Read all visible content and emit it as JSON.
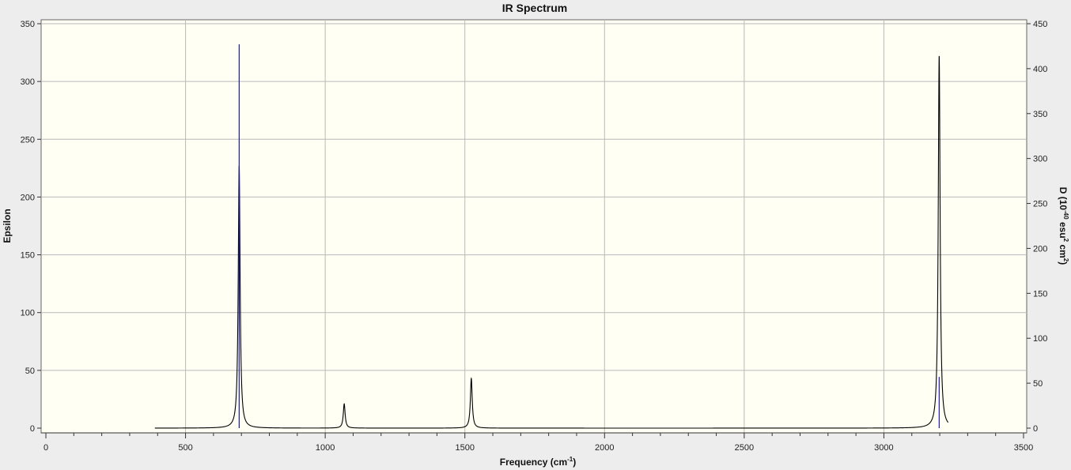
{
  "chart_data": {
    "type": "line",
    "title": "IR Spectrum",
    "xlabel": {
      "main": "Frequency (cm",
      "sup": "-1",
      "tail": ")"
    },
    "ylabel_left": "Epsilon",
    "ylabel_right": {
      "p1": "D (10",
      "sup1": "-40",
      "p2": " esu",
      "sup2": "2",
      "p3": " cm",
      "sup3": "2",
      "p4": ")"
    },
    "xlim": [
      0,
      3500
    ],
    "ylim_left": [
      0,
      350
    ],
    "ylim_right": [
      0,
      450
    ],
    "x_ticks": [
      0,
      500,
      1000,
      1500,
      2000,
      2500,
      3000,
      3500
    ],
    "y_ticks_left": [
      0,
      50,
      100,
      150,
      200,
      250,
      300,
      350
    ],
    "y_ticks_right": [
      0,
      50,
      100,
      150,
      200,
      250,
      300,
      350,
      400,
      450
    ],
    "grid": true,
    "plot_background": "#fffff4",
    "series": [
      {
        "kind": "spectrum",
        "color": "#000000",
        "x_range": [
          390,
          3230
        ],
        "peaks": [
          {
            "center": 692,
            "height": 227,
            "hwhm": 4
          },
          {
            "center": 1068,
            "height": 21,
            "hwhm": 4
          },
          {
            "center": 1523,
            "height": 43,
            "hwhm": 4
          },
          {
            "center": 3198,
            "height": 322,
            "hwhm": 4
          }
        ]
      },
      {
        "kind": "stick",
        "color": "#1a1aa6",
        "sticks": [
          {
            "x": 692,
            "d": 427
          },
          {
            "x": 3198,
            "d": 57
          }
        ]
      }
    ]
  }
}
